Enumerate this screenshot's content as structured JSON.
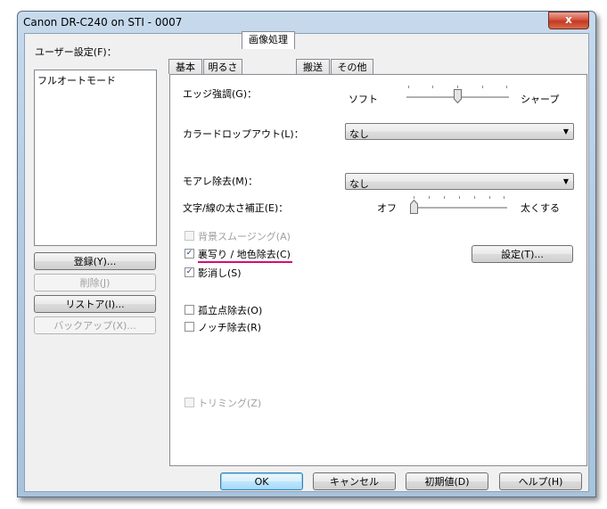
{
  "window": {
    "title": "Canon DR-C240 on STI - 0007",
    "close_label": "x"
  },
  "left": {
    "user_settings_label": "ユーザー設定(F)：",
    "list_items": [
      "フルオートモード"
    ],
    "buttons": {
      "register": "登録(Y)...",
      "delete": "削除(J)",
      "restore": "リストア(I)...",
      "backup": "バックアップ(X)..."
    }
  },
  "tabs": [
    "基本",
    "明るさ",
    "画像処理",
    "搬送",
    "その他"
  ],
  "active_tab": "画像処理",
  "panel": {
    "edge_label": "エッジ強調(G)：",
    "edge_left": "ソフト",
    "edge_right": "シャープ",
    "edge_level": 0.5,
    "dropout_label": "カラードロップアウト(L)：",
    "dropout_value": "なし",
    "moire_label": "モアレ除去(M)：",
    "moire_value": "なし",
    "thickness_label": "文字/線の太さ補正(E)：",
    "thickness_left": "オフ",
    "thickness_right": "太くする",
    "thickness_level": 0.0,
    "bg_smoothing": "背景スムージング(A)",
    "bleed_through": "裏写り / 地色除去(C)",
    "settings_button": "設定(T)...",
    "shadow": "影消し(S)",
    "isolated_dot": "孤立点除去(O)",
    "notch": "ノッチ除去(R)",
    "trimming": "トリミング(Z)",
    "highlight_color": "#d0107a"
  },
  "footer": {
    "ok": "OK",
    "cancel": "キャンセル",
    "defaults": "初期値(D)",
    "help": "ヘルプ(H)"
  }
}
